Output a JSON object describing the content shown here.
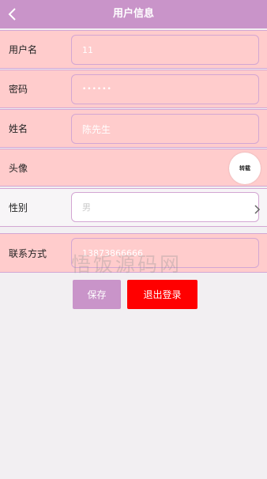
{
  "header": {
    "title": "用户信息",
    "back_icon": "chevron-left-icon"
  },
  "form": {
    "username": {
      "label": "用户名",
      "value": "11"
    },
    "password": {
      "label": "密码",
      "value": "••••••"
    },
    "name": {
      "label": "姓名",
      "value": "陈先生"
    },
    "avatar": {
      "label": "头像",
      "button_text": "转载"
    },
    "gender": {
      "label": "性别",
      "value": "男"
    },
    "contact": {
      "label": "联系方式",
      "value": "13873866666"
    }
  },
  "actions": {
    "save_label": "保存",
    "logout_label": "退出登录"
  },
  "watermark": "悟饭源码网",
  "colors": {
    "header": "#c994c9",
    "row_pink": "#ffcccc",
    "logout": "#ff0000",
    "save": "#c994c9"
  }
}
